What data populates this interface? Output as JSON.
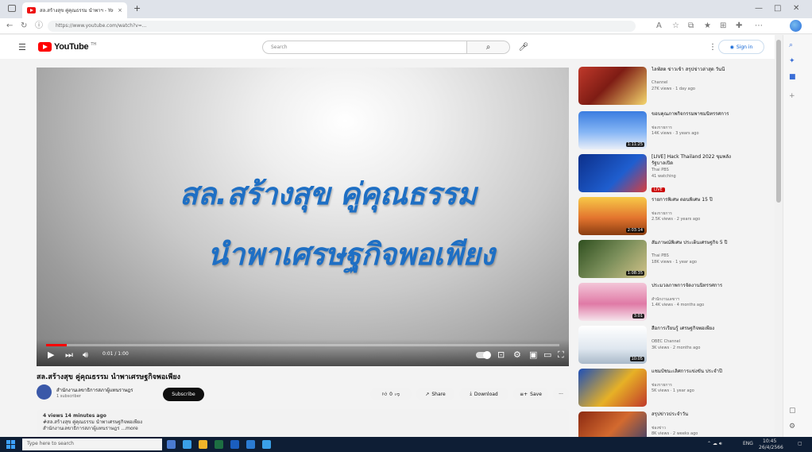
{
  "browser": {
    "tab_title": "สล.สร้างสุข คู่คุณธรรม นำพาฯ - YouTube",
    "tab_close": "×",
    "new_tab": "+",
    "url": "https://www.youtube.com/watch?v=...",
    "window_controls": [
      "—",
      "□",
      "✕"
    ]
  },
  "youtube": {
    "logo_text": "YouTube",
    "logo_sup": "TH",
    "search_placeholder": "Search",
    "sign_in": "Sign in"
  },
  "video": {
    "overlay_line1": "สล.สร้างสุข คู่คุณธรรม",
    "overlay_line2": "นำพาเศรษฐกิจพอเพียง",
    "timer": "0:01 / 1:00",
    "progress": 0.04,
    "title": "สล.สร้างสุข คู่คุณธรรม นำพาเศรษฐกิจพอเพียง",
    "channel": "สำนักงานเลขาธิการสภาผู้แทนราษฎร",
    "subscribers": "1 subscriber",
    "subscribe": "Subscribe",
    "like": "0",
    "share": "Share",
    "download": "Download",
    "save": "Save",
    "more": "···",
    "description": [
      "4 views  14 minutes ago",
      "#สล.สร้างสุข คู่คุณธรรม นำพาเศรษฐกิจพอเพียง",
      "สำนักงานเลขาธิการสภาผู้แทนราษฎร ...more"
    ]
  },
  "recommendations": [
    {
      "title": "ไลฟ์สด ข่าวเช้า สรุปข่าวล่าสุด วันนี้",
      "channel": "Channel",
      "meta": "27K views · 1 day ago",
      "duration": "",
      "live": ""
    },
    {
      "title": "ขอบคุณภาพกิจกรรมพาชมนิทรรศการ",
      "channel": "ช่องรายการ",
      "meta": "14K views · 3 years ago",
      "duration": "1:11:25",
      "live": ""
    },
    {
      "title": "[LIVE] Hack Thailand 2022 ขุมพลังรัฐบาลเปิด",
      "channel": "Thai PBS",
      "meta": "41 watching",
      "duration": "",
      "live": "LIVE"
    },
    {
      "title": "รายการพิเศษ ตอนพิเศษ 15 ปี",
      "channel": "ช่องรายการ",
      "meta": "2.5K views · 2 years ago",
      "duration": "2:03:14",
      "live": ""
    },
    {
      "title": "สัมภาษณ์พิเศษ ประเด็นเศรษฐกิจ 5 ปี",
      "channel": "Thai PBS",
      "meta": "18K views · 1 year ago",
      "duration": "1:08:35",
      "live": ""
    },
    {
      "title": "ประมวลภาพการจัดงานนิทรรศการ",
      "channel": "สำนักงานเลขาฯ",
      "meta": "1.4K views · 4 months ago",
      "duration": "3:01",
      "live": ""
    },
    {
      "title": "สื่อการเรียนรู้ เศรษฐกิจพอเพียง",
      "channel": "OBEC Channel",
      "meta": "3K views · 2 months ago",
      "duration": "10:05",
      "live": ""
    },
    {
      "title": "แชมป์ชนะเลิศการแข่งขัน ประจำปี",
      "channel": "ช่องรายการ",
      "meta": "5K views · 1 year ago",
      "duration": "",
      "live": ""
    },
    {
      "title": "สรุปข่าวประจำวัน",
      "channel": "ช่องข่าว",
      "meta": "8K views · 2 weeks ago",
      "duration": "",
      "live": ""
    }
  ],
  "taskbar": {
    "search": "Type here to search",
    "time": "10:45",
    "date": "26/4/2566",
    "lang": "ENG"
  }
}
